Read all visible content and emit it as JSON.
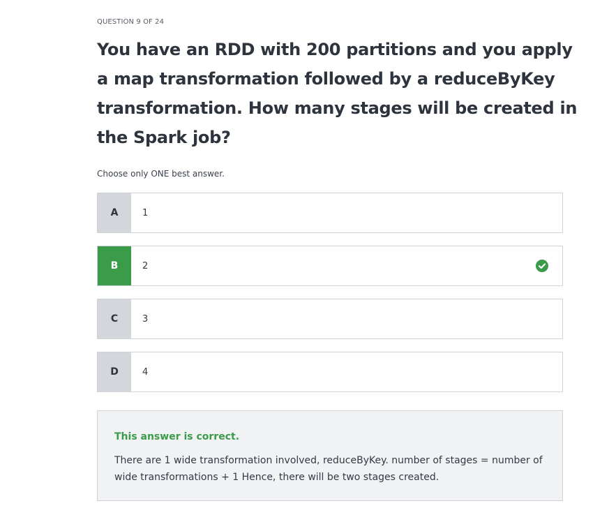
{
  "quiz": {
    "counter": "QUESTION 9 OF 24",
    "question": "You have an RDD with 200 partitions and you apply a map transformation followed by a reduceByKey transformation. How many stages will be created in the Spark job?",
    "instruction": "Choose only ONE best answer.",
    "options": [
      {
        "letter": "A",
        "text": "1",
        "selected": false
      },
      {
        "letter": "B",
        "text": "2",
        "selected": true
      },
      {
        "letter": "C",
        "text": "3",
        "selected": false
      },
      {
        "letter": "D",
        "text": "4",
        "selected": false
      }
    ],
    "feedback": {
      "title": "This answer is correct.",
      "explanation": "There are 1 wide transformation involved, reduceByKey. number of stages = number of wide transformations + 1 Hence, there will be two stages created."
    }
  },
  "colors": {
    "correct": "#3a9b48",
    "letter_bg": "#d3d6db",
    "feedback_bg": "#f1f2f4"
  },
  "icons": {
    "selected_option": "check-circle-icon"
  }
}
